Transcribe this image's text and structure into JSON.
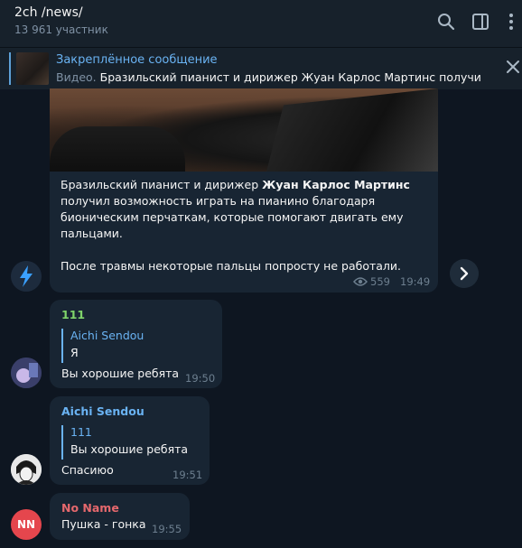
{
  "header": {
    "title": "2ch /news/",
    "subtitle": "13 961 участник",
    "icons": [
      "search-icon",
      "sidebar-toggle-icon",
      "more-icon"
    ]
  },
  "pinned": {
    "title": "Закреплённое сообщение",
    "prefix": "Видео.",
    "text": " Бразильский пианист и дирижер Жуан Карлос Мартинс получил в..."
  },
  "post": {
    "line1_a": "Бразильский пианист и дирижер ",
    "line1_b": "Жуан Карлос Мартинс",
    "line2": "получил возможность играть на пианино благодаря",
    "line3": "бионическим перчаткам, которые помогают двигать ему",
    "line4": "пальцами.",
    "line5": "После травмы некоторые пальцы попросту не работали.",
    "views": "559",
    "time": "19:49"
  },
  "messages": [
    {
      "name": "111",
      "reply_name": "Aichi Sendou",
      "reply_text": "Я",
      "text": "Вы хорошие ребята",
      "time": "19:50"
    },
    {
      "name": "Aichi Sendou",
      "reply_name": "111",
      "reply_text": "Вы хорошие ребята",
      "text": "Спасиюо",
      "time": "19:51"
    },
    {
      "name": "No Name",
      "text": "Пушка - гонка",
      "time": "19:55",
      "avatar_initials": "NN"
    }
  ],
  "colors": {
    "background": "#0e1621",
    "panel": "#17212b",
    "bubble": "#182533",
    "accent": "#6ab3f3",
    "name_111": "#7fd36a",
    "name_noname": "#e5686d",
    "avatar_nn": "#e5464d"
  }
}
